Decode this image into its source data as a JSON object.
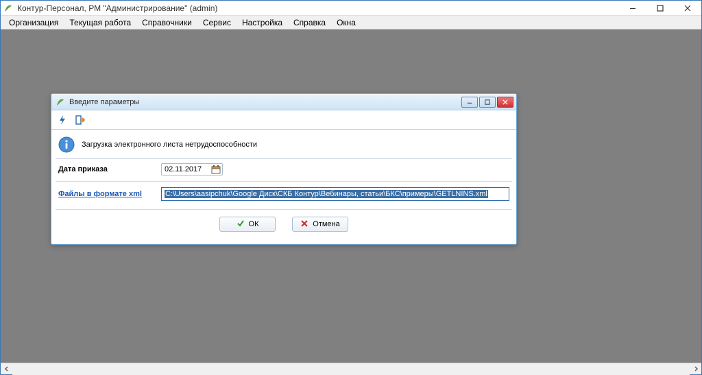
{
  "main_window": {
    "title": "Контур-Персонал, РМ \"Администрирование\" (admin)"
  },
  "menu": {
    "items": [
      "Организация",
      "Текущая работа",
      "Справочники",
      "Сервис",
      "Настройка",
      "Справка",
      "Окна"
    ]
  },
  "dialog": {
    "title": "Введите параметры",
    "info_text": "Загрузка электронного листа нетрудоспособности",
    "date_label": "Дата приказа",
    "date_value": "02.11.2017",
    "files_label": "Файлы в формате xml",
    "path_value": "C:\\Users\\aasipchuk\\Google Диск\\СКБ Контур\\Вебинары, статьи\\БКС\\примеры\\GETLNINS.xml",
    "ok_label": "ОК",
    "cancel_label": "Отмена"
  }
}
